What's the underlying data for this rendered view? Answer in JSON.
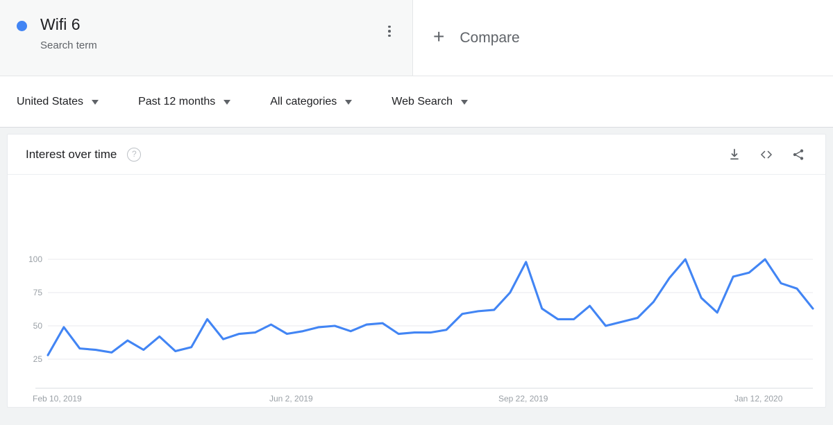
{
  "term_card": {
    "title": "Wifi 6",
    "subtitle": "Search term",
    "dot_color": "#4285f4",
    "menu_icon": "more-vert-icon"
  },
  "compare": {
    "plus": "+",
    "label": "Compare"
  },
  "filters": [
    {
      "label": "United States",
      "name": "location"
    },
    {
      "label": "Past 12 months",
      "name": "time-range"
    },
    {
      "label": "All categories",
      "name": "category"
    },
    {
      "label": "Web Search",
      "name": "search-type"
    }
  ],
  "chart_card": {
    "title": "Interest over time",
    "help_icon": "?",
    "actions": [
      {
        "name": "download-icon",
        "label": "Download"
      },
      {
        "name": "embed-icon",
        "label": "Embed"
      },
      {
        "name": "share-icon",
        "label": "Share"
      }
    ]
  },
  "chart_data": {
    "type": "line",
    "title": "Interest over time",
    "xlabel": "",
    "ylabel": "",
    "ylim": [
      0,
      100
    ],
    "yticks": [
      25,
      50,
      75,
      100
    ],
    "grid": true,
    "legend": [
      "Wifi 6"
    ],
    "legend_position": "top",
    "line_color": "#4285f4",
    "xticks": [
      "Feb 10, 2019",
      "Jun 2, 2019",
      "Sep 22, 2019",
      "Jan 12, 2020"
    ],
    "xtick_indices": [
      0,
      16,
      32,
      48
    ],
    "x": [
      "Feb 10, 2019",
      "Feb 17, 2019",
      "Feb 24, 2019",
      "Mar 3, 2019",
      "Mar 10, 2019",
      "Mar 17, 2019",
      "Mar 24, 2019",
      "Mar 31, 2019",
      "Apr 7, 2019",
      "Apr 14, 2019",
      "Apr 21, 2019",
      "Apr 28, 2019",
      "May 5, 2019",
      "May 12, 2019",
      "May 19, 2019",
      "May 26, 2019",
      "Jun 2, 2019",
      "Jun 9, 2019",
      "Jun 16, 2019",
      "Jun 23, 2019",
      "Jun 30, 2019",
      "Jul 7, 2019",
      "Jul 14, 2019",
      "Jul 21, 2019",
      "Jul 28, 2019",
      "Aug 4, 2019",
      "Aug 11, 2019",
      "Aug 18, 2019",
      "Aug 25, 2019",
      "Sep 1, 2019",
      "Sep 8, 2019",
      "Sep 15, 2019",
      "Sep 22, 2019",
      "Sep 29, 2019",
      "Oct 6, 2019",
      "Oct 13, 2019",
      "Oct 20, 2019",
      "Oct 27, 2019",
      "Nov 3, 2019",
      "Nov 10, 2019",
      "Nov 17, 2019",
      "Nov 24, 2019",
      "Dec 1, 2019",
      "Dec 8, 2019",
      "Dec 15, 2019",
      "Dec 22, 2019",
      "Dec 29, 2019",
      "Jan 5, 2020",
      "Jan 12, 2020"
    ],
    "values": [
      28,
      49,
      33,
      32,
      30,
      39,
      32,
      42,
      31,
      34,
      55,
      40,
      44,
      45,
      51,
      44,
      46,
      49,
      50,
      46,
      51,
      52,
      44,
      45,
      45,
      47,
      59,
      61,
      62,
      75,
      98,
      63,
      55,
      55,
      65,
      50,
      53,
      56,
      68,
      86,
      100,
      71,
      60,
      87,
      90,
      100,
      82,
      78,
      63
    ],
    "series": [
      {
        "name": "Wifi 6",
        "color": "#4285f4",
        "values": [
          28,
          49,
          33,
          32,
          30,
          39,
          32,
          42,
          31,
          34,
          55,
          40,
          44,
          45,
          51,
          44,
          46,
          49,
          50,
          46,
          51,
          52,
          44,
          45,
          45,
          47,
          59,
          61,
          62,
          75,
          98,
          63,
          55,
          55,
          65,
          50,
          53,
          56,
          68,
          86,
          100,
          71,
          60,
          87,
          90,
          100,
          82,
          78,
          63
        ]
      }
    ]
  }
}
